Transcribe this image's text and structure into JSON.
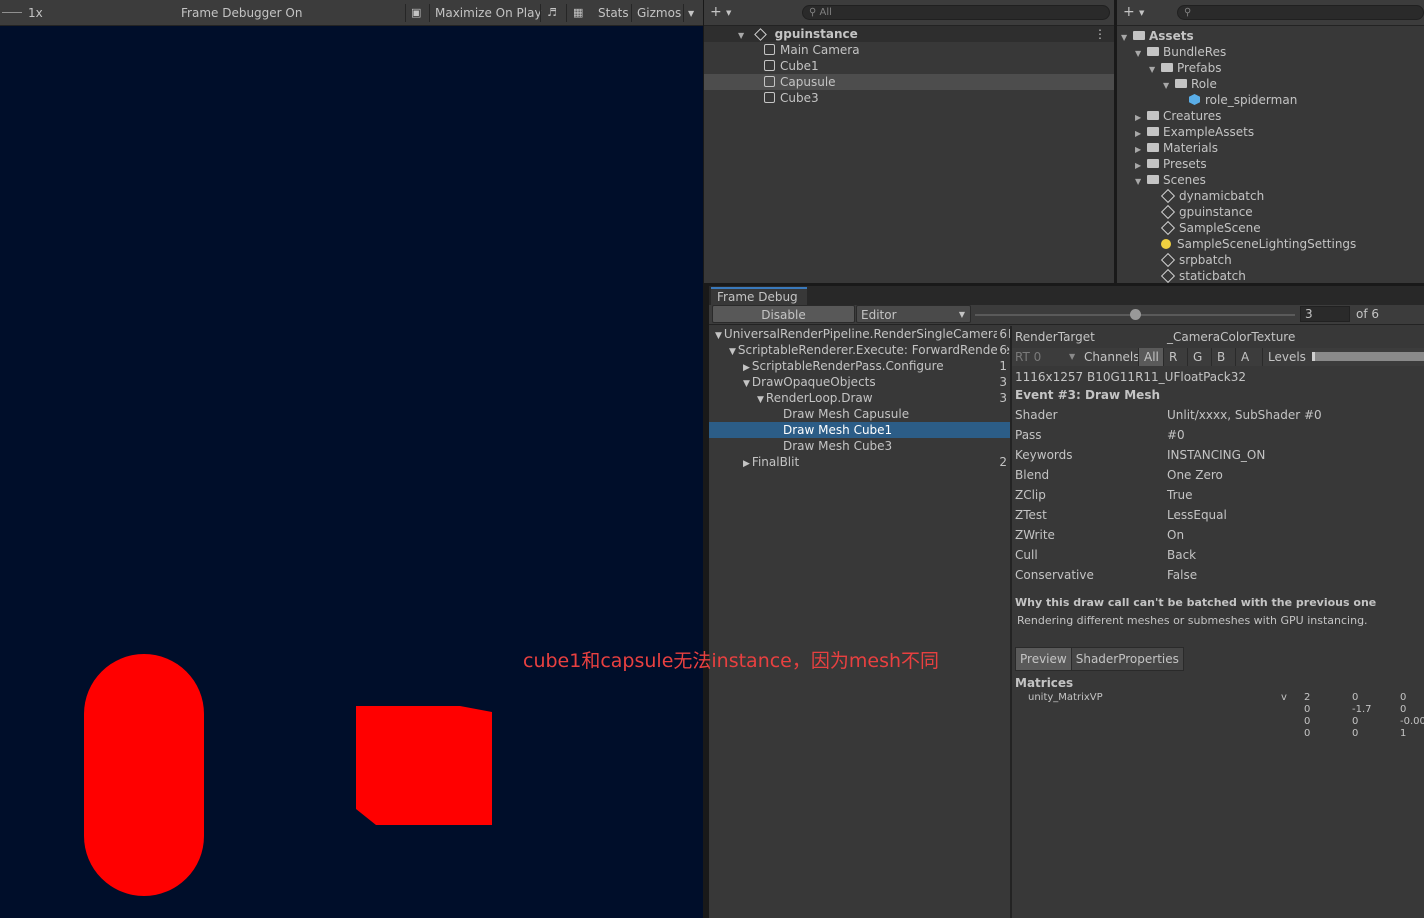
{
  "game": {
    "scale": "1x",
    "frame_debugger_status": "Frame Debugger On",
    "maximize_label": "Maximize On Play",
    "stats_label": "Stats",
    "gizmos_label": "Gizmos",
    "shape_color": "#ff0000",
    "bg_color": "#000e2a"
  },
  "hierarchy": {
    "search_placeholder": "All",
    "scene_name": "gpuinstance",
    "items": [
      "Main Camera",
      "Cube1",
      "Capusule",
      "Cube3"
    ],
    "selected_item": "Capusule"
  },
  "project": {
    "root": "Assets",
    "items": [
      {
        "label": "BundleRes"
      },
      {
        "label": "Prefabs"
      },
      {
        "label": "Role"
      },
      {
        "label": "role_spiderman"
      },
      {
        "label": "Creatures"
      },
      {
        "label": "ExampleAssets"
      },
      {
        "label": "Materials"
      },
      {
        "label": "Presets"
      },
      {
        "label": "Scenes"
      },
      {
        "label": "dynamicbatch"
      },
      {
        "label": "gpuinstance"
      },
      {
        "label": "SampleScene"
      },
      {
        "label": "SampleSceneLightingSettings"
      },
      {
        "label": "srpbatch"
      },
      {
        "label": "staticbatch"
      }
    ]
  },
  "frame_debug": {
    "tab_label": "Frame Debug",
    "disable_label": "Disable",
    "target_label": "Editor",
    "event_index": "3",
    "event_total": "of 6",
    "slider_position": 0.5,
    "tree": [
      {
        "label": "UniversalRenderPipeline.RenderSingleCamera: I",
        "count": "6"
      },
      {
        "label": "ScriptableRenderer.Execute: ForwardRendere",
        "count": "6"
      },
      {
        "label": "ScriptableRenderPass.Configure",
        "count": "1"
      },
      {
        "label": "DrawOpaqueObjects",
        "count": "3"
      },
      {
        "label": "RenderLoop.Draw",
        "count": "3"
      },
      {
        "label": "Draw Mesh Capusule",
        "count": ""
      },
      {
        "label": "Draw Mesh Cube1",
        "count": ""
      },
      {
        "label": "Draw Mesh Cube3",
        "count": ""
      },
      {
        "label": "FinalBlit",
        "count": "2"
      }
    ],
    "selected_event": "Draw Mesh Cube1",
    "detail": {
      "render_target_key": "RenderTarget",
      "render_target_value": "_CameraColorTexture",
      "rt": "RT 0",
      "channels_label": "Channels",
      "channels": [
        "All",
        "R",
        "G",
        "B",
        "A"
      ],
      "levels_label": "Levels",
      "format": "1116x1257 B10G11R11_UFloatPack32",
      "event_title": "Event #3: Draw Mesh",
      "properties": [
        {
          "key": "Shader",
          "value": "Unlit/xxxx, SubShader #0"
        },
        {
          "key": "Pass",
          "value": "#0"
        },
        {
          "key": "Keywords",
          "value": "INSTANCING_ON"
        },
        {
          "key": "Blend",
          "value": "One Zero"
        },
        {
          "key": "ZClip",
          "value": "True"
        },
        {
          "key": "ZTest",
          "value": "LessEqual"
        },
        {
          "key": "ZWrite",
          "value": "On"
        },
        {
          "key": "Cull",
          "value": "Back"
        },
        {
          "key": "Conservative",
          "value": "False"
        }
      ],
      "batch_title": "Why this draw call can't be batched with the previous one",
      "batch_reason": "Rendering different meshes or submeshes with GPU instancing.",
      "tabs": [
        "Preview",
        "ShaderProperties"
      ],
      "matrices_label": "Matrices",
      "matrix_name": "unity_MatrixVP",
      "matrix_flag": "v",
      "matrix_rows": [
        [
          "2",
          "0",
          "0"
        ],
        [
          "0",
          "-1.7",
          "0"
        ],
        [
          "0",
          "0",
          "-0.00"
        ],
        [
          "0",
          "0",
          "1"
        ]
      ]
    }
  },
  "annotation": "cube1和capsule无法instance，因为mesh不同"
}
